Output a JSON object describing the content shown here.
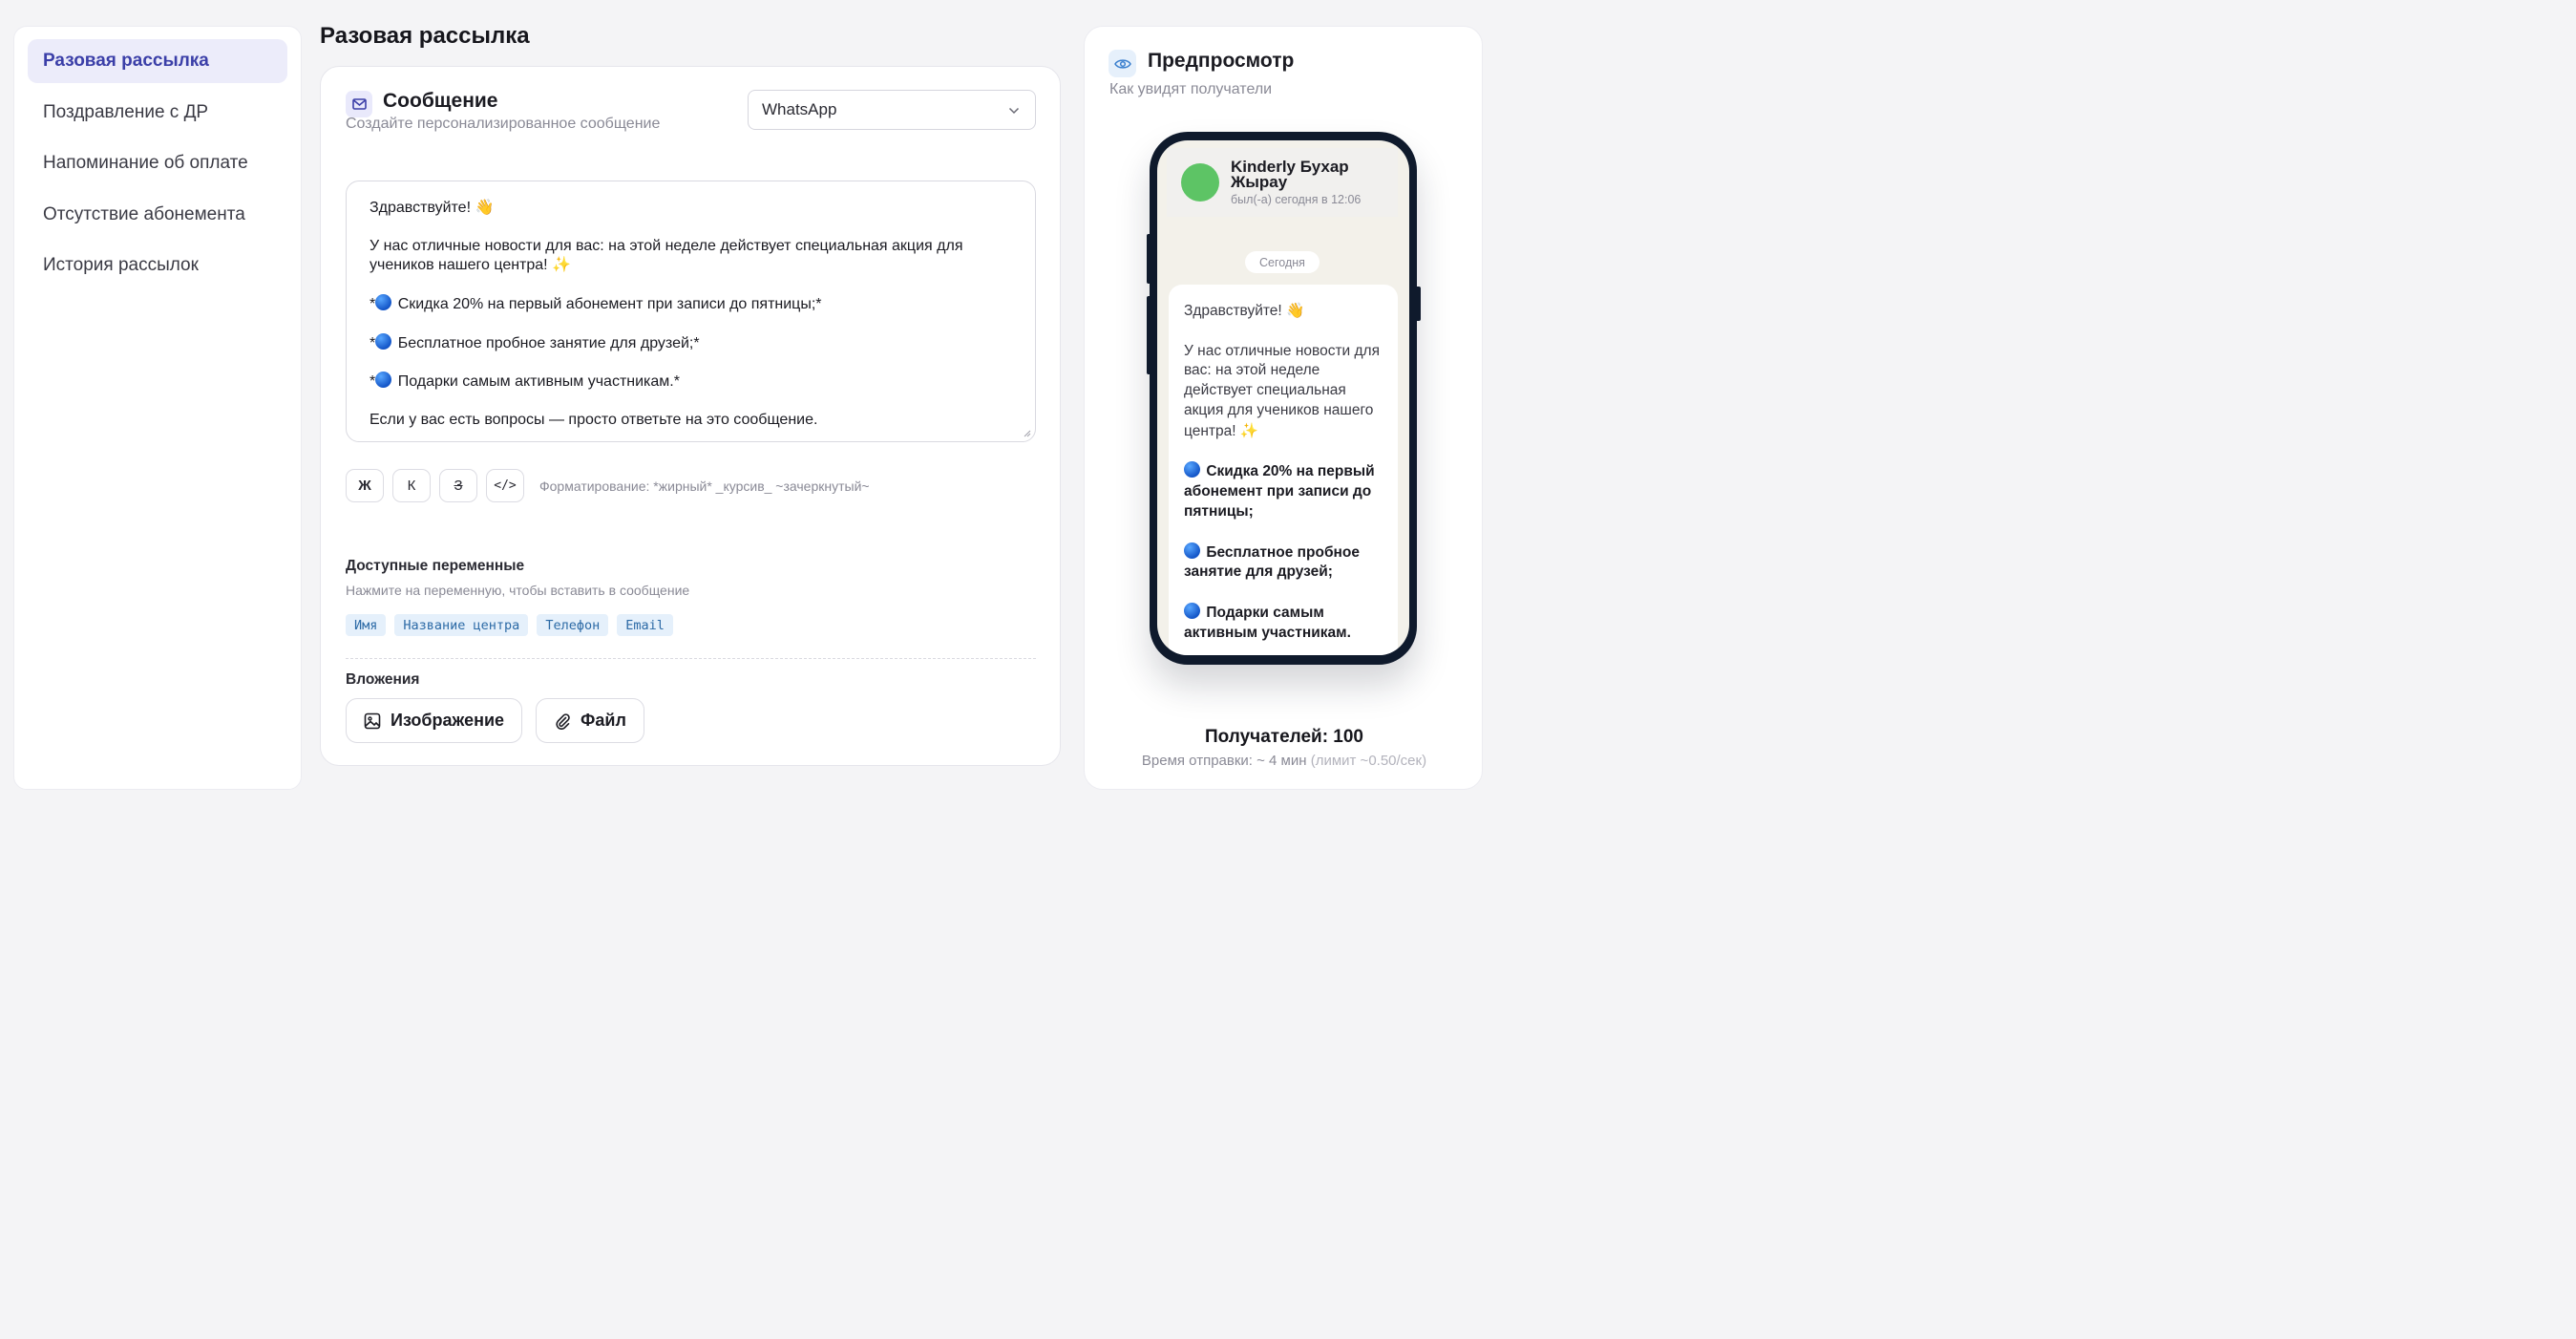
{
  "sidebar": {
    "items": [
      {
        "label": "Разовая рассылка",
        "active": true
      },
      {
        "label": "Поздравление с ДР"
      },
      {
        "label": "Напоминание об оплате"
      },
      {
        "label": "Отсутствие абонемента"
      },
      {
        "label": "История рассылок"
      }
    ]
  },
  "page": {
    "title": "Разовая рассылка"
  },
  "message": {
    "title": "Сообщение",
    "subtitle": "Создайте персонализированное сообщение",
    "channel": "WhatsApp",
    "editor": {
      "greeting": "Здравствуйте!",
      "intro": "У нас отличные новости для вас: на этой неделе действует специальная акция для учеников нашего центра!",
      "item1": "Скидка 20% на первый абонемент при записи до пятницы;*",
      "item2": "Бесплатное пробное занятие для друзей;*",
      "item3": "Подарки самым активным участникам.*",
      "outro": "Если у вас есть вопросы — просто ответьте на это сообщение."
    },
    "format": {
      "bold": "Ж",
      "italic": "К",
      "strike": "З",
      "code": "</>",
      "hint": "Форматирование: *жирный* _курсив_ ~зачеркнутый~"
    },
    "variables": {
      "title": "Доступные переменные",
      "subtitle": "Нажмите на переменную, чтобы вставить в сообщение",
      "chips": [
        "Имя",
        "Название центра",
        "Телефон",
        "Email"
      ]
    },
    "attachments": {
      "title": "Вложения",
      "image_label": "Изображение",
      "file_label": "Файл"
    }
  },
  "preview": {
    "title": "Предпросмотр",
    "subtitle": "Как увидят получатели",
    "contact_name": "Kinderly Бухар Жырау",
    "contact_status": "был(-а) сегодня в 12:06",
    "date_label": "Сегодня",
    "bubble": {
      "greeting": "Здравствуйте!",
      "intro": "У нас отличные новости для вас: на этой неделе действует специальная акция для учеников нашего центра!",
      "item1": "Скидка 20% на первый абонемент при записи до пятницы;",
      "item2": "Бесплатное пробное занятие для друзей;",
      "item3": "Подарки самым активным участникам."
    },
    "recipients": "Получателей: 100",
    "send_time": "Время отправки: ~ 4 мин",
    "limit": "(лимит ~0.50/сек)"
  },
  "colors": {
    "accent": "#3b3fa8",
    "accent_bg": "#ececfa",
    "avatar": "#5dc465",
    "chip_text": "#2c6aa6"
  }
}
